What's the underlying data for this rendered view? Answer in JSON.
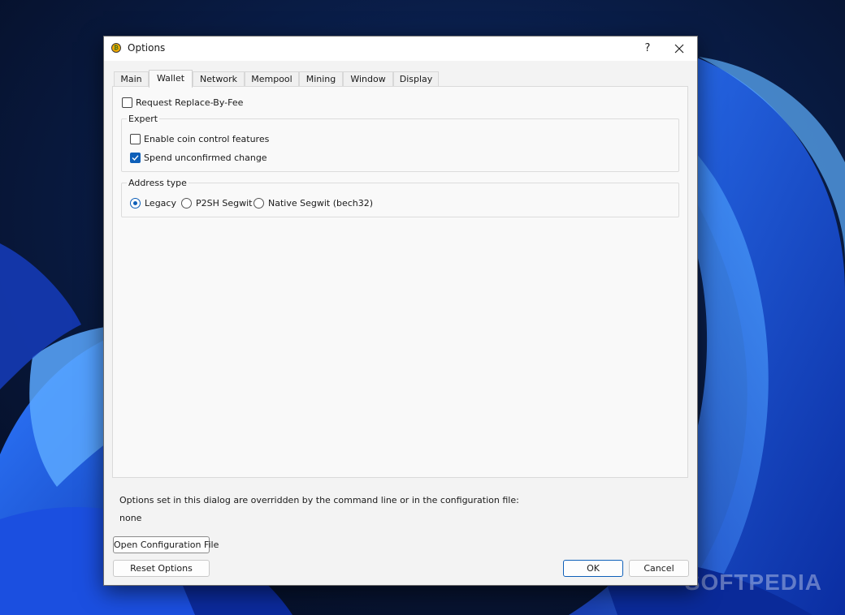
{
  "window": {
    "title": "Options",
    "help_label": "?",
    "icon": "bitcoin-coin-icon"
  },
  "tabs": [
    {
      "label": "Main",
      "active": false
    },
    {
      "label": "Wallet",
      "active": true
    },
    {
      "label": "Network",
      "active": false
    },
    {
      "label": "Mempool",
      "active": false
    },
    {
      "label": "Mining",
      "active": false
    },
    {
      "label": "Window",
      "active": false
    },
    {
      "label": "Display",
      "active": false
    }
  ],
  "wallet": {
    "rbf": {
      "label": "Request Replace-By-Fee",
      "checked": false
    },
    "expert": {
      "title": "Expert",
      "coin_control": {
        "label": "Enable coin control features",
        "checked": false
      },
      "spend_unconfirmed": {
        "label": "Spend unconfirmed change",
        "checked": true
      }
    },
    "address_type": {
      "title": "Address type",
      "options": [
        {
          "label": "Legacy",
          "selected": true
        },
        {
          "label": "P2SH Segwit",
          "selected": false
        },
        {
          "label": "Native Segwit (bech32)",
          "selected": false
        }
      ]
    }
  },
  "overridden": {
    "text": "Options set in this dialog are overridden by the command line or in the configuration file:",
    "value": "none"
  },
  "buttons": {
    "open_config": "Open Configuration File",
    "reset": "Reset Options",
    "ok": "OK",
    "cancel": "Cancel"
  },
  "watermark": "SOFTPEDIA",
  "colors": {
    "accent": "#0e5fb8",
    "wallpaper_dark": "#07122b",
    "wallpaper_blue": "#1f5fe8"
  }
}
